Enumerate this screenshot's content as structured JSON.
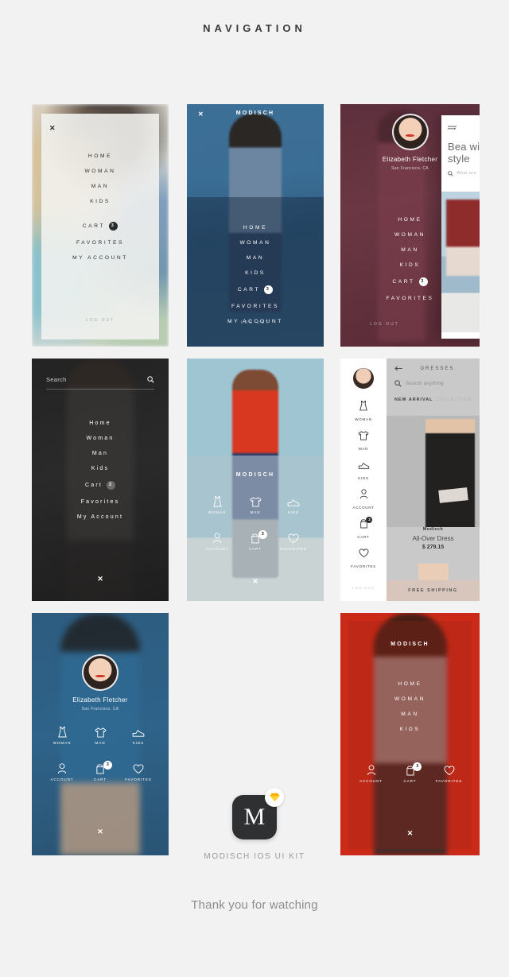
{
  "page": {
    "title": "NAVIGATION",
    "kit_title": "MODISCH IOS UI KIT",
    "thanks": "Thank you for watching",
    "app_letter": "M",
    "bg_color": "#f2f2f2"
  },
  "brand": "MODISCH",
  "labels": {
    "close": "✕",
    "logout": "LOG OUT",
    "cart_badge": "3"
  },
  "screens": {
    "s1": {
      "close": "✕",
      "menu": [
        "HOME",
        "WOMAN",
        "MAN",
        "KIDS"
      ],
      "menu2": [
        "CART",
        "FAVORITES",
        "MY ACCOUNT"
      ],
      "cart_badge": "3",
      "logout": "LOG OUT"
    },
    "s2": {
      "brand": "MODISCH",
      "close": "✕",
      "menu": [
        "HOME",
        "WOMAN",
        "MAN",
        "KIDS"
      ],
      "cart": "CART",
      "cart_badge": "3",
      "menu_after": [
        "FAVORITES",
        "MY ACCOUNT"
      ],
      "logout": "LOG OUT"
    },
    "s3": {
      "user_name": "Elizabeth Fletcher",
      "user_location": "San Francisco, CA",
      "menu": [
        "HOME",
        "WOMAN",
        "MAN",
        "KIDS"
      ],
      "cart": "CART",
      "cart_badge": "3",
      "menu_after": [
        "FAVORITES"
      ],
      "logout": "LOG OUT",
      "card_title": "Bea with style",
      "card_search": "What are",
      "card_menu_icon": "hamburger-icon"
    },
    "s4": {
      "search_placeholder": "Search",
      "menu": [
        "Home",
        "Woman",
        "Man",
        "Kids"
      ],
      "cart": "Cart",
      "cart_badge": "3",
      "menu_after": [
        "Favorites",
        "My Account"
      ],
      "close": "✕"
    },
    "s5": {
      "brand": "MODISCH",
      "row1": [
        {
          "label": "WOMAN",
          "icon": "dress-icon"
        },
        {
          "label": "MAN",
          "icon": "tshirt-icon"
        },
        {
          "label": "KIDS",
          "icon": "sneaker-icon"
        }
      ],
      "row2": [
        {
          "label": "ACCOUNT",
          "icon": "user-icon"
        },
        {
          "label": "CART",
          "icon": "bag-icon",
          "badge": "3"
        },
        {
          "label": "FAVORITES",
          "icon": "heart-icon"
        }
      ],
      "close": "✕"
    },
    "s6": {
      "drawer_items": [
        {
          "label": "WOMAN",
          "icon": "dress-icon"
        },
        {
          "label": "MAN",
          "icon": "tshirt-icon"
        },
        {
          "label": "KIDS",
          "icon": "sneaker-icon"
        },
        {
          "label": "ACCOUNT",
          "icon": "user-icon"
        },
        {
          "label": "CART",
          "icon": "bag-icon",
          "badge": "3"
        },
        {
          "label": "FAVORITES",
          "icon": "heart-icon"
        }
      ],
      "logout": "LOG OUT",
      "content_title": "DRESSES",
      "back_icon": "arrow-left-icon",
      "search_placeholder": "Search anything",
      "tab_active": "NEW ARRIVAL",
      "tab_inactive": "COLLECTION",
      "product_brand": "Modisch",
      "product_name": "All-Over Dress",
      "product_price": "$ 279.15",
      "shipping": "FREE SHIPPING"
    },
    "s7": {
      "user_name": "Elizabeth Fletcher",
      "user_location": "San Francisco, CA",
      "row1": [
        {
          "label": "WOMAN",
          "icon": "dress-icon"
        },
        {
          "label": "MAN",
          "icon": "tshirt-icon"
        },
        {
          "label": "KIDS",
          "icon": "sneaker-icon"
        }
      ],
      "row2": [
        {
          "label": "ACCOUNT",
          "icon": "user-icon"
        },
        {
          "label": "CART",
          "icon": "bag-icon",
          "badge": "3"
        },
        {
          "label": "FAVORITES",
          "icon": "heart-icon"
        }
      ],
      "close": "✕"
    },
    "s8": {
      "brand": "MODISCH",
      "menu": [
        "HOME",
        "WOMAN",
        "MAN",
        "KIDS"
      ],
      "row": [
        {
          "label": "ACCOUNT",
          "icon": "user-icon"
        },
        {
          "label": "CART",
          "icon": "bag-icon",
          "badge": "3"
        },
        {
          "label": "FAVORITES",
          "icon": "heart-icon"
        }
      ],
      "close": "✕"
    }
  }
}
